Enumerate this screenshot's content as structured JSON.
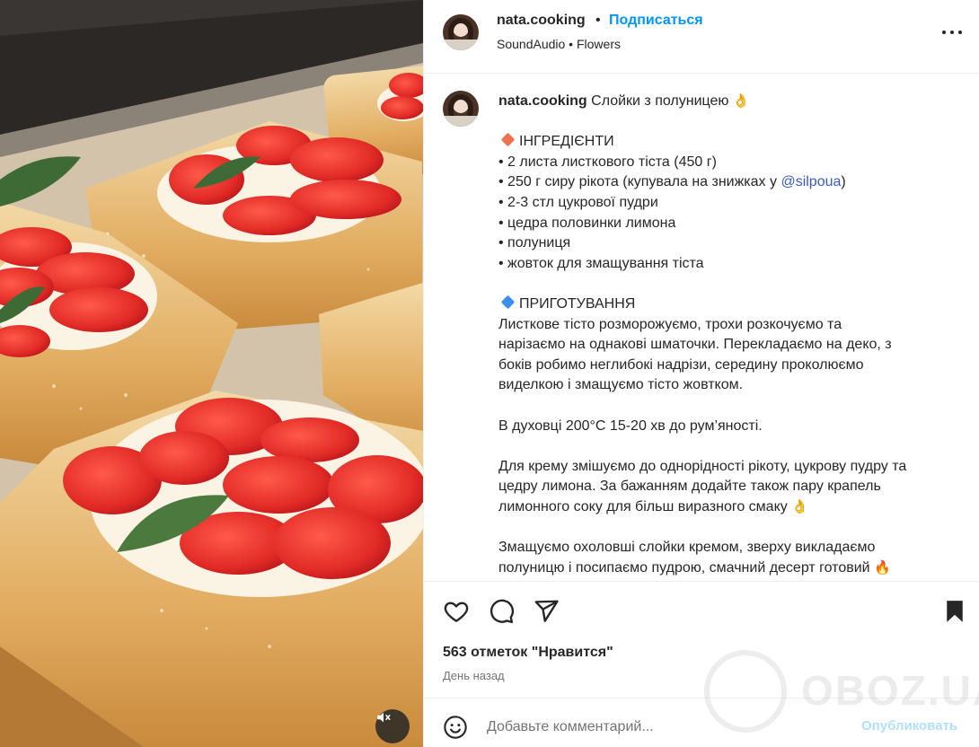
{
  "post": {
    "username": "nata.cooking",
    "separator": "•",
    "follow_label": "Подписаться",
    "audio": "SoundAudio • Flowers",
    "more_icon": "more-horizontal-icon"
  },
  "media": {
    "image_subject": "puff-pastry-strawberry-tarts",
    "mute_icon": "speaker-muted-icon"
  },
  "caption": {
    "username": "nata.cooking",
    "title": "Слойки з полуницею",
    "lines": [
      "ІНГРЕДІЄНТИ",
      "• 2 листа листкового тіста (450 г)",
      "• 250 г сиру рікота (купувала на знижках у ",
      "@silpoua",
      ")",
      "• 2-3 стл цукрової пудри",
      "• цедра половинки лимона",
      "• полуниця",
      "• жовток для змащування тіста",
      "ПРИГОТУВАННЯ",
      "Листкове тісто розморожуємо, трохи розкочуємо та",
      "нарізаємо на однакові шматочки. Перекладаємо на деко, з",
      "боків робимо неглибокі надрізи, середину проколюємо",
      "виделкою і змащуємо тісто жовтком.",
      "В духовці 200°С 15-20 хв до рум’яності.",
      "Для крему змішуємо до однорідності рікоту, цукрову пудру та",
      "цедру лимона. За бажанням додайте також пару крапель",
      "лимонного соку для більш виразного смаку",
      "Змащуємо охоловші слойки кремом, зверху викладаємо",
      "полуницю і посипаємо пудрою, смачний десерт готовий"
    ],
    "emoji": {
      "title": "👌",
      "ok": "👌",
      "fire": "🔥"
    }
  },
  "actions": {
    "like_icon": "heart-icon",
    "comment_icon": "comment-bubble-icon",
    "share_icon": "paper-plane-icon",
    "save_icon": "bookmark-icon",
    "likes_text": "563 отметок \"Нравится\"",
    "time_text": "День назад"
  },
  "comment": {
    "emoji_icon": "smiley-icon",
    "placeholder": "Добавьте комментарий...",
    "publish_label": "Опубликовать"
  },
  "watermark": {
    "text": "OBOZ.UA"
  }
}
